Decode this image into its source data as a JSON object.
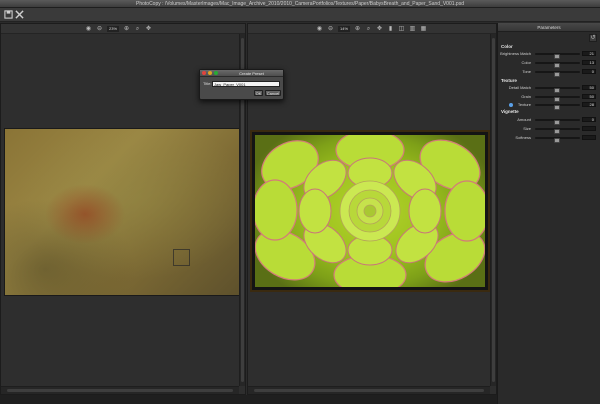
{
  "window": {
    "title": "PhotoCopy : /Volumes/MasterImages/Mac_Image_Archive_2010/2010_CameraPortfolios/Textures/Paper/BabysBreath_and_Paper_Sand_V001.psd"
  },
  "toolbar": {
    "icons": [
      "save-icon",
      "close-icon"
    ]
  },
  "left_pane": {
    "zoom": "23%"
  },
  "right_pane": {
    "zoom": "14%"
  },
  "dialog": {
    "title": "Create Preset",
    "title_label": "Title:",
    "title_value": "Jaw_Paper_V001",
    "ok_label": "OK",
    "cancel_label": "Cancel"
  },
  "parameters": {
    "header": "Parameters",
    "sections": {
      "color": "Color",
      "texture": "Texture",
      "vignette": "Vignette"
    },
    "rows": {
      "brightness": {
        "label": "Brightness Match",
        "value": "21",
        "fraction": 0.5
      },
      "color": {
        "label": "Color",
        "value": "13",
        "fraction": 0.5
      },
      "tone": {
        "label": "Tone",
        "value": "0",
        "fraction": 0.5
      },
      "detail": {
        "label": "Detail Match",
        "value": "50",
        "fraction": 0.5
      },
      "grain": {
        "label": "Grain",
        "value": "50",
        "fraction": 0.5
      },
      "texture": {
        "label": "Texture",
        "value": "28",
        "fraction": 0.5
      },
      "amount": {
        "label": "Amount",
        "value": "0",
        "fraction": 0.5
      },
      "size": {
        "label": "Size",
        "value": "",
        "fraction": 0.5
      },
      "softness": {
        "label": "Softness",
        "value": "",
        "fraction": 0.5
      }
    }
  },
  "colors": {
    "accent": "#5aa0e8",
    "close_light": "#e0443e",
    "minimize_light": "#dea123",
    "zoom_light": "#27aa35"
  }
}
